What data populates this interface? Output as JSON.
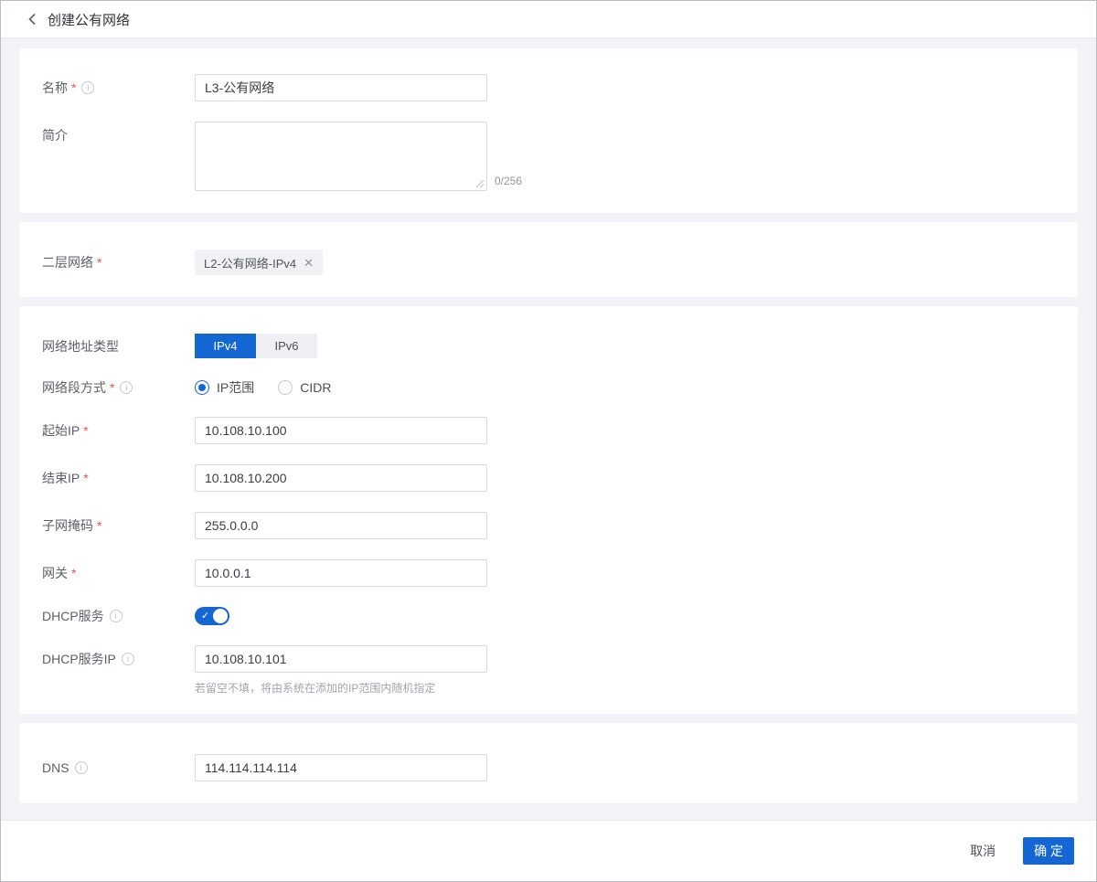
{
  "header": {
    "title": "创建公有网络"
  },
  "basic": {
    "name_label": "名称",
    "name_value": "L3-公有网络",
    "desc_label": "简介",
    "desc_value": "",
    "desc_counter": "0/256"
  },
  "l2": {
    "label": "二层网络",
    "tag": "L2-公有网络-IPv4",
    "remove": "✕"
  },
  "network": {
    "addr_type_label": "网络地址类型",
    "tabs": [
      {
        "label": "IPv4",
        "selected": true
      },
      {
        "label": "IPv6",
        "selected": false
      }
    ],
    "segment_label": "网络段方式",
    "radios": [
      {
        "label": "IP范围",
        "selected": true
      },
      {
        "label": "CIDR",
        "selected": false
      }
    ],
    "start_ip_label": "起始IP",
    "start_ip_value": "10.108.10.100",
    "end_ip_label": "结束IP",
    "end_ip_value": "10.108.10.200",
    "mask_label": "子网掩码",
    "mask_value": "255.0.0.0",
    "gateway_label": "网关",
    "gateway_value": "10.0.0.1",
    "dhcp_label": "DHCP服务",
    "dhcp_on": true,
    "dhcp_check": "✓",
    "dhcp_ip_label": "DHCP服务IP",
    "dhcp_ip_value": "10.108.10.101",
    "dhcp_ip_hint": "若留空不填，将由系统在添加的IP范围内随机指定"
  },
  "dns": {
    "label": "DNS",
    "value": "114.114.114.114"
  },
  "footer": {
    "cancel": "取消",
    "confirm": "确 定"
  },
  "colors": {
    "accent": "#1467d2",
    "required": "#f0504a",
    "page_bg": "#f1f3f7"
  }
}
